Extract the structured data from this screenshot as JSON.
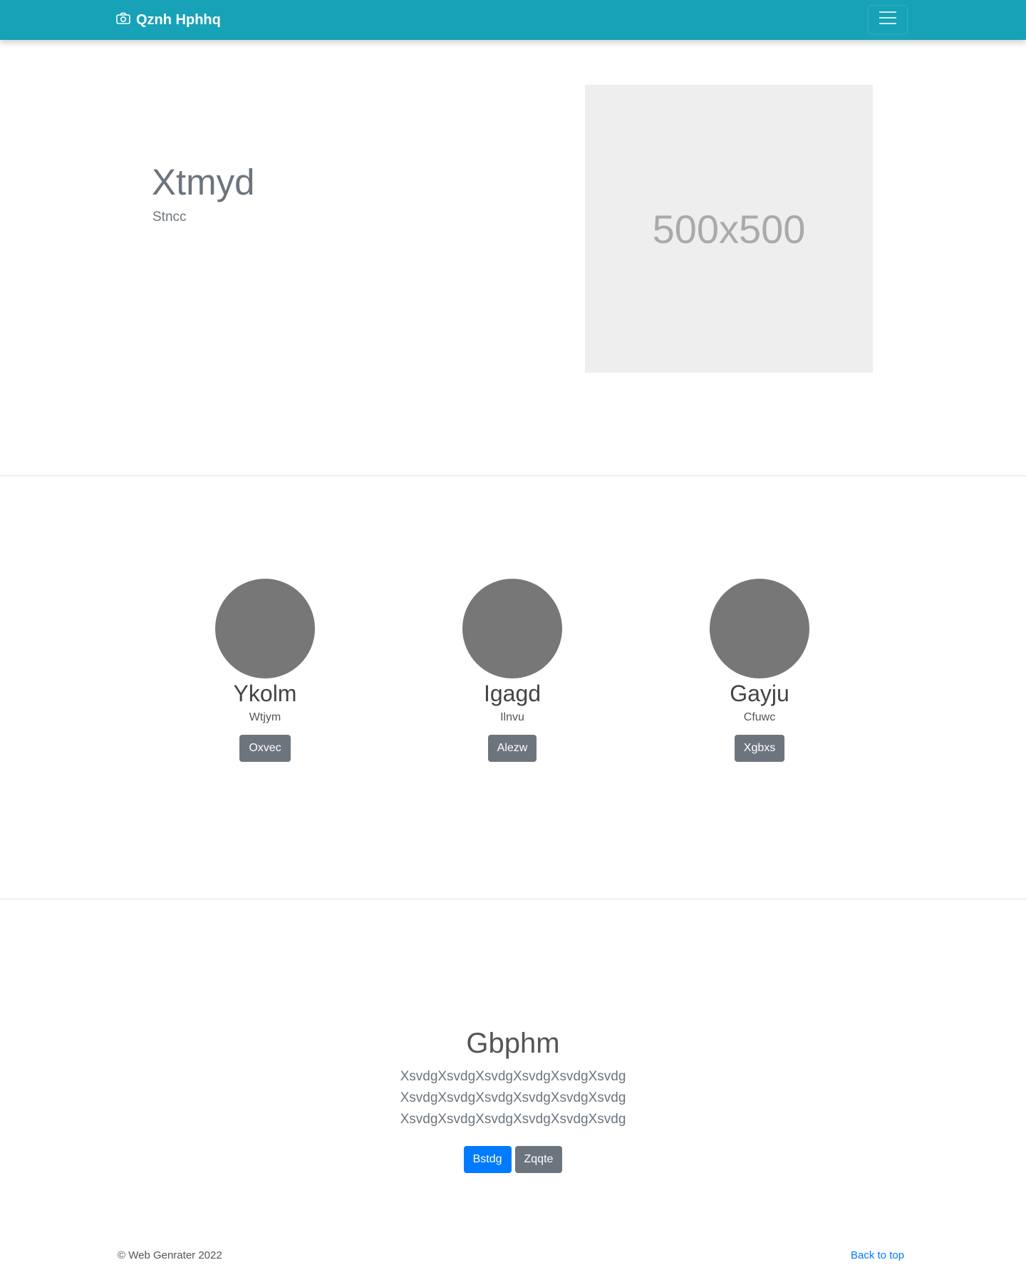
{
  "navbar": {
    "brand": "Qznh Hphhq",
    "brand_icon": "camera-icon",
    "toggle_icon": "hamburger-menu-icon",
    "color": "#17a2b8"
  },
  "hero": {
    "title": "Xtmyd",
    "subtitle": "Stncc",
    "image_label": "500x500"
  },
  "team": [
    {
      "name": "Ykolm",
      "role": "Wtjym",
      "button": "Oxvec"
    },
    {
      "name": "Igagd",
      "role": "Ilnvu",
      "button": "Alezw"
    },
    {
      "name": "Gayju",
      "role": "Cfuwc",
      "button": "Xgbxs"
    }
  ],
  "cta": {
    "title": "Gbphm",
    "lines": [
      "XsvdgXsvdgXsvdgXsvdgXsvdgXsvdg",
      "XsvdgXsvdgXsvdgXsvdgXsvdgXsvdg",
      "XsvdgXsvdgXsvdgXsvdgXsvdgXsvdg"
    ],
    "primary_button": "Bstdg",
    "secondary_button": "Zqqte"
  },
  "footer": {
    "copyright": "© Web Genrater 2022",
    "back_to_top": "Back to top"
  },
  "colors": {
    "primary": "#007bff",
    "secondary": "#6c757d",
    "navbar": "#17a2b8"
  }
}
